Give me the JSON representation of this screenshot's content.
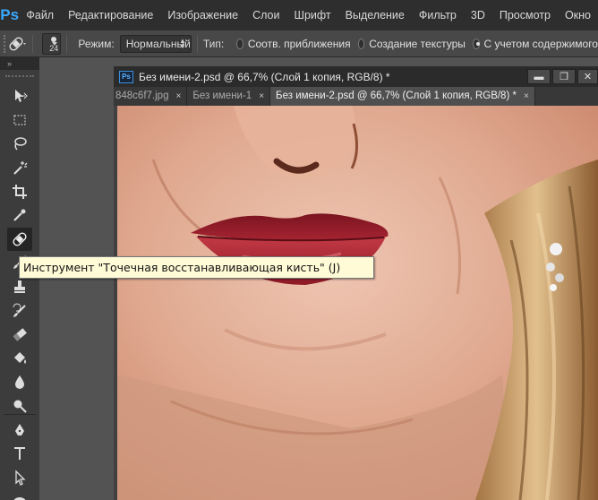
{
  "app": {
    "logo": "Ps",
    "menu": [
      "Файл",
      "Редактирование",
      "Изображение",
      "Слои",
      "Шрифт",
      "Выделение",
      "Фильтр",
      "3D",
      "Просмотр",
      "Окно"
    ]
  },
  "options_bar": {
    "brush_size": "24",
    "mode_label": "Режим:",
    "mode_value": "Нормальный",
    "type_label": "Тип:",
    "radio_1": "Соотв. приближения",
    "radio_2": "Создание текстуры",
    "radio_3": "С учетом содержимого"
  },
  "toolbar": {
    "collapse_glyph": "»",
    "tools": [
      "move-tool",
      "marquee-tool",
      "lasso-tool",
      "magic-wand-tool",
      "crop-tool",
      "eyedropper-tool",
      "spot-healing-brush-tool",
      "brush-tool",
      "clone-stamp-tool",
      "history-brush-tool",
      "eraser-tool",
      "paint-bucket-tool",
      "blur-tool",
      "dodge-tool",
      "pen-tool",
      "type-tool",
      "path-selection-tool",
      "shape-tool"
    ],
    "active_tool": "spot-healing-brush-tool"
  },
  "document": {
    "title_icon": "Ps",
    "title": "Без имени-2.psd @ 66,7% (Слой 1 копия, RGB/8) *",
    "window_buttons": {
      "minimize": "▬",
      "maximize": "❐",
      "close": "✕"
    },
    "tabs": [
      {
        "label": "848c6f7.jpg",
        "close": "×",
        "active": false
      },
      {
        "label": "Без имени-1",
        "close": "×",
        "active": false
      },
      {
        "label": "Без имени-2.psd @ 66,7% (Слой 1 копия, RGB/8) *",
        "close": "×",
        "active": true
      }
    ]
  },
  "tooltip": {
    "text": "Инструмент \"Точечная восстанавливающая кисть\" (J)"
  },
  "colors": {
    "menubar_bg": "#2e2e2e",
    "panel_bg": "#3c3c3c",
    "accent_logo": "#39a9ff",
    "tooltip_bg": "#fffbd7"
  }
}
